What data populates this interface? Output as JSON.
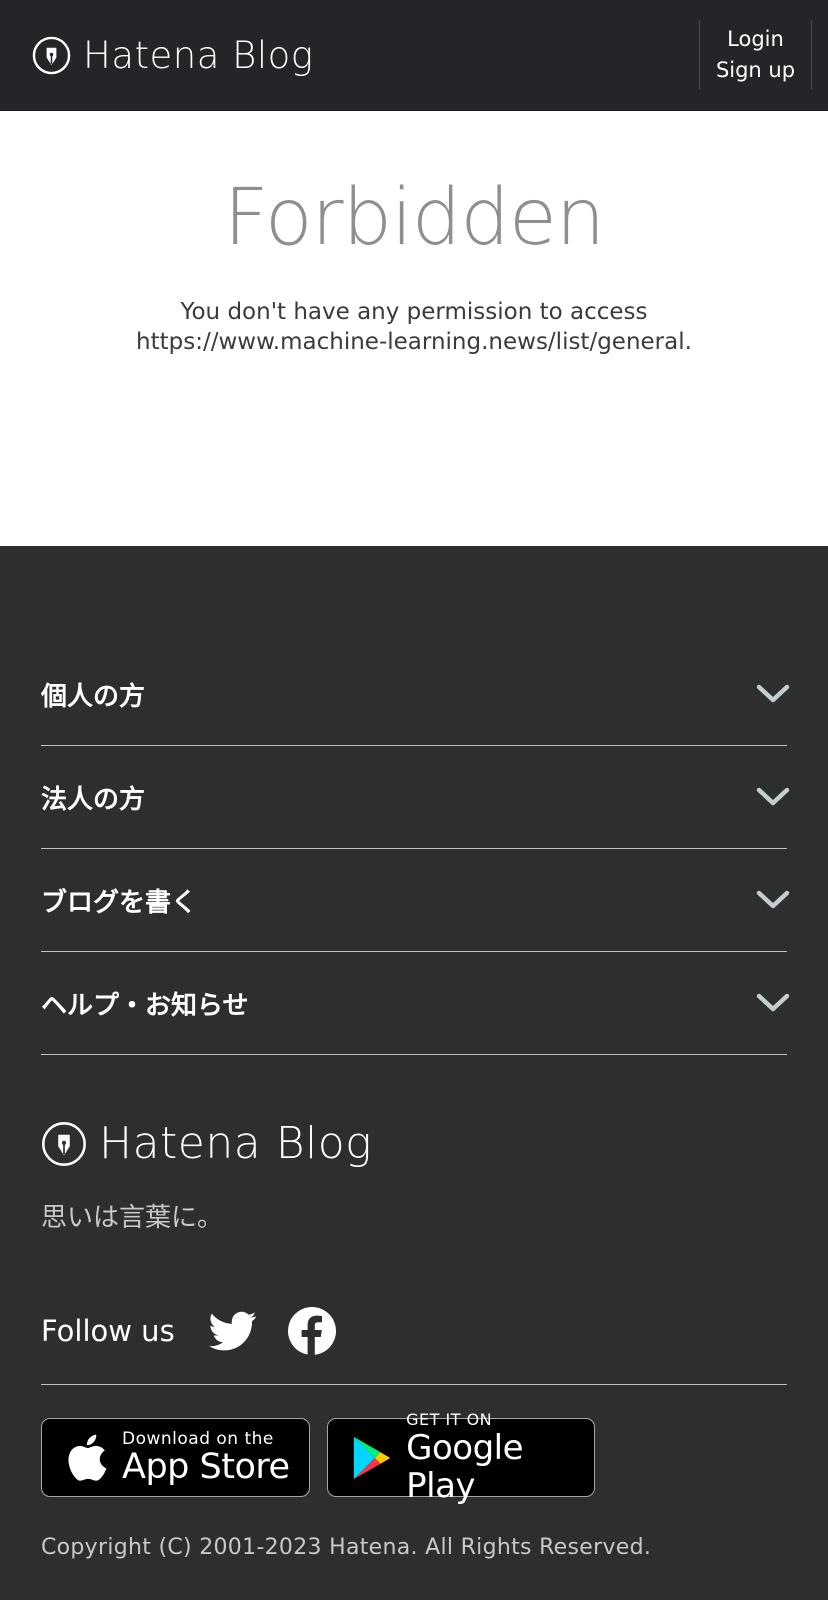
{
  "header": {
    "brand": "Hatena Blog",
    "brand_icon": "hatena-pen-icon",
    "login_label": "Login",
    "signup_label": "Sign up"
  },
  "main": {
    "title": "Forbidden",
    "message_line1": "You don't have any permission to access",
    "message_line2": "https://www.machine-learning.news/list/general."
  },
  "footer": {
    "accordion": [
      {
        "label": "個人の方"
      },
      {
        "label": "法人の方"
      },
      {
        "label": "ブログを書く"
      },
      {
        "label": "ヘルプ・お知らせ"
      }
    ],
    "brand": "Hatena Blog",
    "tagline": "思いは言葉に。",
    "follow_label": "Follow us",
    "social_icons": [
      "twitter-icon",
      "facebook-icon"
    ],
    "app_store": {
      "small": "Download on the",
      "big": "App Store"
    },
    "google_play": {
      "small": "GET IT ON",
      "big": "Google Play"
    },
    "copyright": "Copyright (C) 2001-2023 Hatena. All Rights Reserved."
  },
  "colors": {
    "header_bg": "#242528",
    "footer_bg": "#2d2e30",
    "divider": "#b7c3c6",
    "forbidden_text": "#8f8f8f"
  }
}
